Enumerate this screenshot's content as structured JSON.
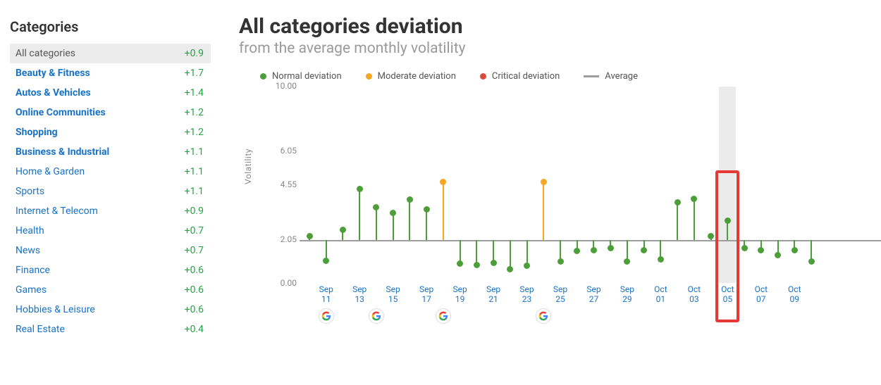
{
  "sidebar": {
    "heading": "Categories",
    "items": [
      {
        "label": "All categories",
        "value": "+0.9",
        "bold": false,
        "neutral": true,
        "selected": true
      },
      {
        "label": "Beauty & Fitness",
        "value": "+1.7",
        "bold": true,
        "neutral": false,
        "selected": false
      },
      {
        "label": "Autos & Vehicles",
        "value": "+1.4",
        "bold": true,
        "neutral": false,
        "selected": false
      },
      {
        "label": "Online Communities",
        "value": "+1.2",
        "bold": true,
        "neutral": false,
        "selected": false
      },
      {
        "label": "Shopping",
        "value": "+1.2",
        "bold": true,
        "neutral": false,
        "selected": false
      },
      {
        "label": "Business & Industrial",
        "value": "+1.1",
        "bold": true,
        "neutral": false,
        "selected": false
      },
      {
        "label": "Home & Garden",
        "value": "+1.1",
        "bold": false,
        "neutral": false,
        "selected": false
      },
      {
        "label": "Sports",
        "value": "+1.1",
        "bold": false,
        "neutral": false,
        "selected": false
      },
      {
        "label": "Internet & Telecom",
        "value": "+0.9",
        "bold": false,
        "neutral": false,
        "selected": false
      },
      {
        "label": "Health",
        "value": "+0.7",
        "bold": false,
        "neutral": false,
        "selected": false
      },
      {
        "label": "News",
        "value": "+0.7",
        "bold": false,
        "neutral": false,
        "selected": false
      },
      {
        "label": "Finance",
        "value": "+0.6",
        "bold": false,
        "neutral": false,
        "selected": false
      },
      {
        "label": "Games",
        "value": "+0.6",
        "bold": false,
        "neutral": false,
        "selected": false
      },
      {
        "label": "Hobbies & Leisure",
        "value": "+0.6",
        "bold": false,
        "neutral": false,
        "selected": false
      },
      {
        "label": "Real Estate",
        "value": "+0.4",
        "bold": false,
        "neutral": false,
        "selected": false
      }
    ]
  },
  "chart": {
    "title": "All categories deviation",
    "subtitle": "from the average monthly volatility",
    "legend": {
      "normal": {
        "label": "Normal deviation",
        "color": "#4c9f38"
      },
      "moderate": {
        "label": "Moderate deviation",
        "color": "#f5a623"
      },
      "critical": {
        "label": "Critical deviation",
        "color": "#d94b3a"
      },
      "average": {
        "label": "Average",
        "color": "#9e9e9e"
      }
    },
    "ylabel": "Volatility",
    "yticks": [
      "0.00",
      "2.05",
      "4.55",
      "6.05",
      "10.00"
    ],
    "highlight_day": 25,
    "highlight_rect_day": 25,
    "google_markers_at": [
      1,
      4,
      8,
      14
    ]
  },
  "chart_data": {
    "type": "lollipop",
    "title": "All categories deviation",
    "subtitle": "from the average monthly volatility",
    "ylabel": "Volatility",
    "ylim": [
      0,
      10
    ],
    "yticks": [
      0.0,
      2.05,
      4.55,
      6.05,
      10.0
    ],
    "average": 2.05,
    "x_labels_shown": [
      "Sep 11",
      "Sep 13",
      "Sep 15",
      "Sep 17",
      "Sep 19",
      "Sep 21",
      "Sep 23",
      "Sep 25",
      "Sep 27",
      "Sep 29",
      "Oct 01",
      "Oct 03",
      "Oct 05",
      "Oct 07",
      "Oct 09"
    ],
    "severity_levels": [
      "normal",
      "moderate",
      "critical"
    ],
    "points": [
      {
        "date": "Sep 10",
        "value": 2.25,
        "severity": "normal"
      },
      {
        "date": "Sep 11",
        "value": 1.1,
        "severity": "normal"
      },
      {
        "date": "Sep 12",
        "value": 2.55,
        "severity": "normal"
      },
      {
        "date": "Sep 13",
        "value": 4.4,
        "severity": "normal"
      },
      {
        "date": "Sep 14",
        "value": 3.55,
        "severity": "normal"
      },
      {
        "date": "Sep 15",
        "value": 3.3,
        "severity": "normal"
      },
      {
        "date": "Sep 16",
        "value": 3.9,
        "severity": "normal"
      },
      {
        "date": "Sep 17",
        "value": 3.45,
        "severity": "normal"
      },
      {
        "date": "Sep 18",
        "value": 4.7,
        "severity": "moderate"
      },
      {
        "date": "Sep 19",
        "value": 0.95,
        "severity": "normal"
      },
      {
        "date": "Sep 20",
        "value": 0.9,
        "severity": "normal"
      },
      {
        "date": "Sep 21",
        "value": 1.0,
        "severity": "normal"
      },
      {
        "date": "Sep 22",
        "value": 0.7,
        "severity": "normal"
      },
      {
        "date": "Sep 23",
        "value": 0.85,
        "severity": "normal"
      },
      {
        "date": "Sep 24",
        "value": 4.7,
        "severity": "moderate"
      },
      {
        "date": "Sep 25",
        "value": 1.05,
        "severity": "normal"
      },
      {
        "date": "Sep 26",
        "value": 1.55,
        "severity": "normal"
      },
      {
        "date": "Sep 27",
        "value": 1.6,
        "severity": "normal"
      },
      {
        "date": "Sep 28",
        "value": 1.7,
        "severity": "normal"
      },
      {
        "date": "Sep 29",
        "value": 1.05,
        "severity": "normal"
      },
      {
        "date": "Sep 30",
        "value": 1.6,
        "severity": "normal"
      },
      {
        "date": "Oct 01",
        "value": 1.15,
        "severity": "normal"
      },
      {
        "date": "Oct 02",
        "value": 3.8,
        "severity": "normal"
      },
      {
        "date": "Oct 03",
        "value": 3.95,
        "severity": "normal"
      },
      {
        "date": "Oct 04",
        "value": 2.25,
        "severity": "normal"
      },
      {
        "date": "Oct 05",
        "value": 2.95,
        "severity": "normal"
      },
      {
        "date": "Oct 06",
        "value": 1.7,
        "severity": "normal"
      },
      {
        "date": "Oct 07",
        "value": 1.6,
        "severity": "normal"
      },
      {
        "date": "Oct 08",
        "value": 1.35,
        "severity": "normal"
      },
      {
        "date": "Oct 09",
        "value": 1.6,
        "severity": "normal"
      },
      {
        "date": "Oct 10",
        "value": 1.05,
        "severity": "normal"
      }
    ]
  }
}
